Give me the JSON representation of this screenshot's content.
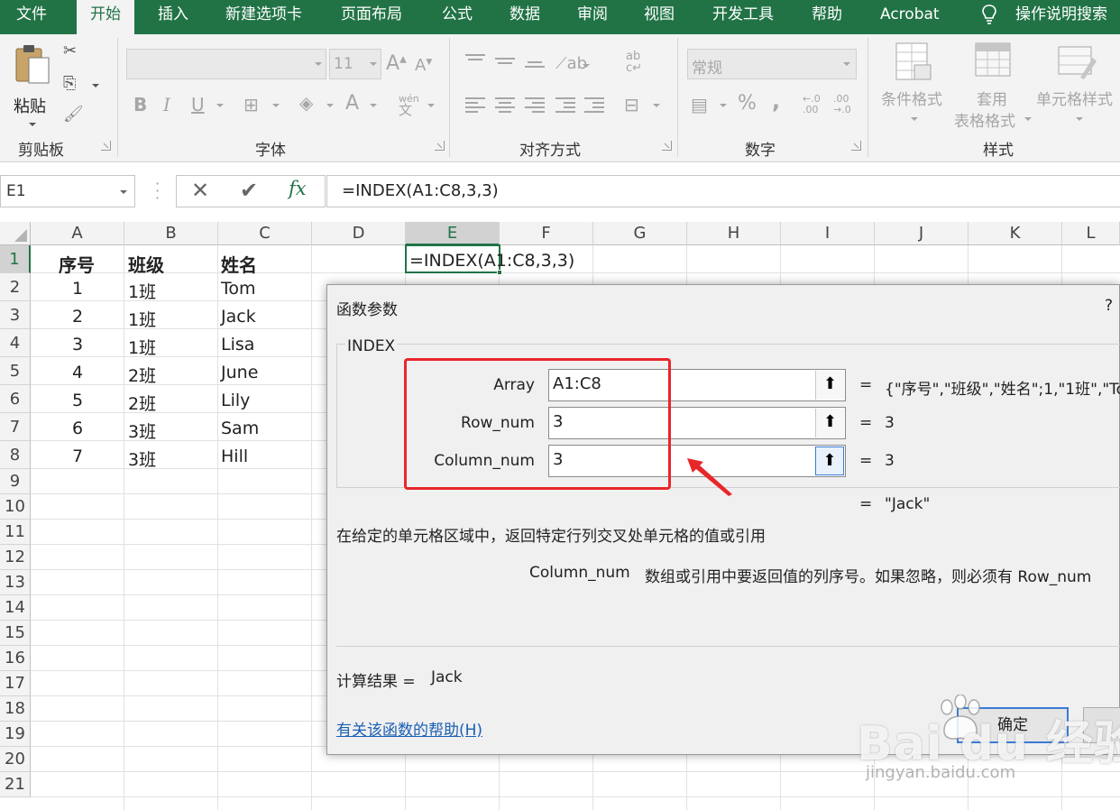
{
  "tabs": [
    "文件",
    "开始",
    "插入",
    "新建选项卡",
    "页面布局",
    "公式",
    "数据",
    "审阅",
    "视图",
    "开发工具",
    "帮助",
    "Acrobat"
  ],
  "tell_me": "操作说明搜索",
  "ribbon": {
    "clipboard": {
      "label": "剪贴板",
      "paste": "粘贴"
    },
    "font": {
      "label": "字体",
      "size": "11",
      "bold": "B",
      "italic": "I",
      "underline": "U",
      "phonetic_top": "wén",
      "phonetic_bottom": "文"
    },
    "alignment": {
      "label": "对齐方式"
    },
    "number": {
      "label": "数字",
      "format": "常规",
      "percent": "%",
      "comma": ","
    },
    "styles": {
      "label": "样式",
      "cond_format": "条件格式",
      "table_format_1": "套用",
      "table_format_2": "表格格式",
      "cell_styles": "单元格样式"
    }
  },
  "formula_bar": {
    "name_box": "E1",
    "formula": "=INDEX(A1:C8,3,3)"
  },
  "columns": [
    "A",
    "B",
    "C",
    "D",
    "E",
    "F",
    "G",
    "H",
    "I",
    "J",
    "K",
    "L"
  ],
  "rows": [
    "1",
    "2",
    "3",
    "4",
    "5",
    "6",
    "7",
    "8",
    "9",
    "10",
    "11",
    "12",
    "13",
    "14",
    "15",
    "16",
    "17",
    "18",
    "19",
    "20",
    "21"
  ],
  "sheet": {
    "header": [
      "序号",
      "班级",
      "姓名"
    ],
    "data": [
      [
        "1",
        "1班",
        "Tom"
      ],
      [
        "2",
        "1班",
        "Jack"
      ],
      [
        "3",
        "1班",
        "Lisa"
      ],
      [
        "4",
        "2班",
        "June"
      ],
      [
        "5",
        "2班",
        "Lily"
      ],
      [
        "6",
        "3班",
        "Sam"
      ],
      [
        "7",
        "3班",
        "Hill"
      ]
    ],
    "e1_text": "=INDEX(A1:C8,3,3)"
  },
  "dialog": {
    "title": "函数参数",
    "help_q": "?",
    "function_name": "INDEX",
    "args": [
      {
        "label": "Array",
        "value": "A1:C8",
        "result": "{\"序号\",\"班级\",\"姓名\";1,\"1班\",\"To"
      },
      {
        "label": "Row_num",
        "value": "3",
        "result": "3"
      },
      {
        "label": "Column_num",
        "value": "3",
        "result": "3"
      }
    ],
    "eq": "=",
    "overall_result": "\"Jack\"",
    "description": "在给定的单元格区域中，返回特定行列交叉处单元格的值或引用",
    "param_name": "Column_num",
    "param_desc": "数组或引用中要返回值的列序号。如果忽略，则必须有 Row_num",
    "calc_label": "计算结果 =",
    "calc_value": "Jack",
    "help_link": "有关该函数的帮助(H)",
    "ok": "确定"
  },
  "watermark": {
    "brand": "Bai du 经验",
    "url": "jingyan.baidu.com"
  },
  "colors": {
    "excel_green": "#217346",
    "annotation_red": "#e8262a",
    "link_blue": "#1a5fb4"
  }
}
